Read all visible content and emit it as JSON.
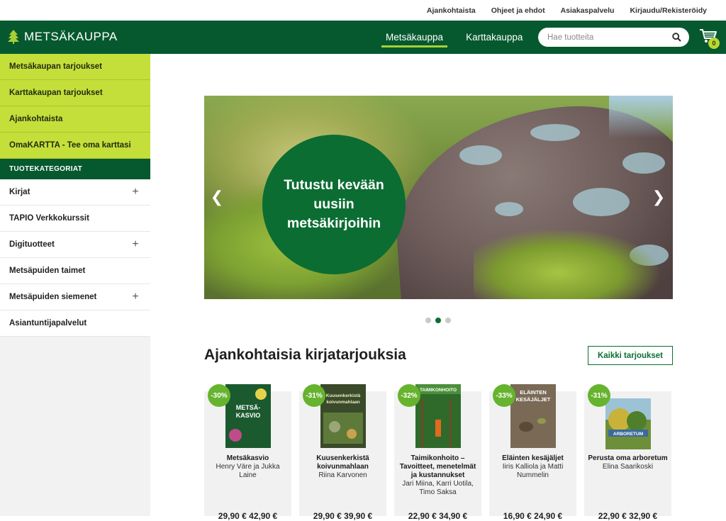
{
  "topbar": {
    "links": [
      "Ajankohtaista",
      "Ohjeet ja ehdot",
      "Asiakaspalvelu",
      "Kirjaudu/Rekisteröidy"
    ]
  },
  "header": {
    "logo_text": "METSÄKAUPPA",
    "nav": [
      {
        "label": "Metsäkauppa",
        "active": true
      },
      {
        "label": "Karttakauppa",
        "active": false
      }
    ],
    "search_placeholder": "Hae tuotteita",
    "cart_count": "0"
  },
  "sidebar": {
    "promo_items": [
      "Metsäkaupan tarjoukset",
      "Karttakaupan tarjoukset",
      "Ajankohtaista",
      "OmaKARTTA - Tee oma karttasi"
    ],
    "categories_header": "TUOTEKATEGORIAT",
    "categories": [
      {
        "label": "Kirjat",
        "expandable": true
      },
      {
        "label": "TAPIO Verkkokurssit",
        "expandable": false
      },
      {
        "label": "Digituotteet",
        "expandable": true
      },
      {
        "label": "Metsäpuiden taimet",
        "expandable": false
      },
      {
        "label": "Metsäpuiden siemenet",
        "expandable": true
      },
      {
        "label": "Asiantuntijapalvelut",
        "expandable": false
      }
    ]
  },
  "hero": {
    "text": "Tutustu kevään uusiin metsäkirjoihin",
    "slides": 3,
    "active_slide": 2
  },
  "section": {
    "title": "Ajankohtaisia kirjatarjouksia",
    "all_button": "Kaikki tarjoukset"
  },
  "products": [
    {
      "discount": "-30%",
      "title": "Metsäkasvio",
      "author": "Henry Väre ja Jukka Laine",
      "price": "29,90 € 42,90 €",
      "cover_color": "#1a5a2e",
      "cover_text": "METSÄ-KASVIO"
    },
    {
      "discount": "-31%",
      "title": "Kuusenkerkistä koivunmahlaan",
      "author": "Riina Karvonen",
      "price": "29,90 € 39,90 €",
      "cover_color": "#3a4a2a",
      "cover_text": "Kuusenkerkistä koivunmahlaan"
    },
    {
      "discount": "-32%",
      "title": "Taimikonhoito – Tavoitteet, menetelmät ja kustannukset",
      "author": "Jari Miina, Karri Uotila, Timo Saksa",
      "price": "22,90 € 34,90 €",
      "cover_color": "#2f6a2a",
      "cover_text": "TAIMIKONHOITO"
    },
    {
      "discount": "-33%",
      "title": "Eläinten kesäjäljet",
      "author": "Iiris Kalliola ja Matti Nummelin",
      "price": "16,90 € 24,90 €",
      "cover_color": "#7a6a55",
      "cover_text": "ELÄINTEN KESÄJÄLJET"
    },
    {
      "discount": "-31%",
      "title": "Perusta oma arboretum",
      "author": "Elina Saarikoski",
      "price": "22,90 € 32,90 €",
      "cover_color": "#6e8f3a",
      "cover_text": "ARBORETUM"
    }
  ]
}
